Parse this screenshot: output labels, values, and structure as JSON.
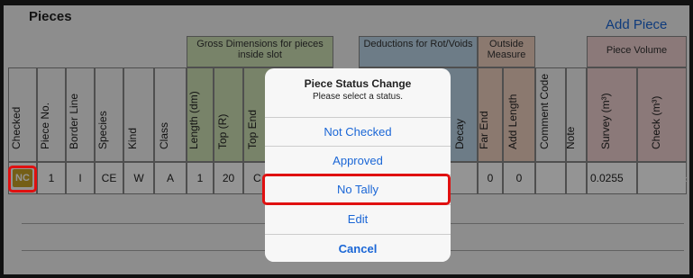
{
  "header": {
    "title": "Pieces",
    "add_piece_label": "Add Piece"
  },
  "groups": {
    "gross": "Gross Dimensions for pieces inside slot",
    "deductions": "Deductions for Rot/Voids",
    "outside": "Outside Measure",
    "volume": "Piece Volume"
  },
  "columns": {
    "checked": "Checked",
    "piece_no": "Piece No.",
    "border_line": "Border Line",
    "species": "Species",
    "kind": "Kind",
    "class": "Class",
    "length": "Length (dm)",
    "top_r": "Top (R)",
    "top_end": "Top End",
    "decay": "Decay",
    "far_end": "Far End",
    "add_length": "Add Length",
    "comment_code": "Comment Code",
    "note": "Note",
    "survey": "Survey (m³)",
    "check": "Check (m³)"
  },
  "row": {
    "status": "NC",
    "piece_no": "1",
    "border_line": "I",
    "species": "CE",
    "kind": "W",
    "class": "A",
    "length": "1",
    "top_r": "20",
    "top_end": "C",
    "far_end": "0",
    "add_length": "0",
    "survey": "0.0255"
  },
  "dialog": {
    "title": "Piece Status Change",
    "subtitle": "Please select a status.",
    "options": [
      "Not Checked",
      "Approved",
      "No Tally",
      "Edit"
    ],
    "cancel": "Cancel"
  },
  "colors": {
    "accent": "#1a66d6",
    "highlight": "#e01010",
    "nc_badge": "#c9a227"
  }
}
